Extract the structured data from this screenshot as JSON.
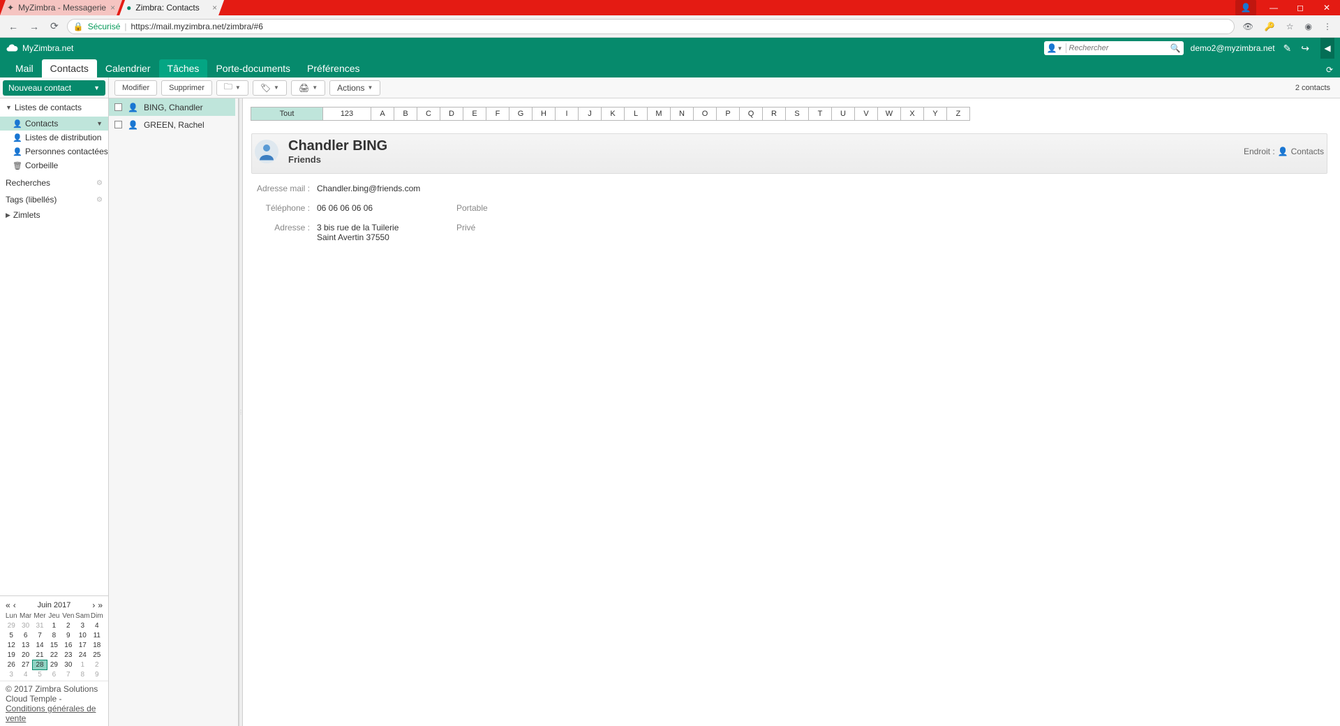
{
  "browser": {
    "tabs": [
      {
        "title": "MyZimbra - Messagerie"
      },
      {
        "title": "Zimbra: Contacts"
      }
    ],
    "url_secure": "Sécurisé",
    "url": "https://mail.myzimbra.net/zimbra/#6"
  },
  "header": {
    "logo": "MyZimbra.net",
    "search_placeholder": "Rechercher",
    "user": "demo2@myzimbra.net"
  },
  "nav": {
    "tabs": [
      "Mail",
      "Contacts",
      "Calendrier",
      "Tâches",
      "Porte-documents",
      "Préférences"
    ]
  },
  "sidebar": {
    "new_button": "Nouveau contact",
    "lists_header": "Listes de contacts",
    "items": [
      {
        "icon": "person",
        "label": "Contacts",
        "active": true,
        "dd": true
      },
      {
        "icon": "person",
        "label": "Listes de distribution"
      },
      {
        "icon": "person",
        "label": "Personnes contactées par m"
      },
      {
        "icon": "trash",
        "label": "Corbeille"
      }
    ],
    "recherches": "Recherches",
    "tags": "Tags (libellés)",
    "zimlets": "Zimlets"
  },
  "toolbar": {
    "modifier": "Modifier",
    "supprimer": "Supprimer",
    "actions": "Actions",
    "count": "2 contacts"
  },
  "alpha": {
    "all": "Tout",
    "num": "123",
    "letters": [
      "A",
      "B",
      "C",
      "D",
      "E",
      "F",
      "G",
      "H",
      "I",
      "J",
      "K",
      "L",
      "M",
      "N",
      "O",
      "P",
      "Q",
      "R",
      "S",
      "T",
      "U",
      "V",
      "W",
      "X",
      "Y",
      "Z"
    ]
  },
  "list": [
    {
      "name": "BING, Chandler",
      "selected": true
    },
    {
      "name": "GREEN, Rachel"
    }
  ],
  "detail": {
    "name": "Chandler BING",
    "org": "Friends",
    "location_label": "Endroit :",
    "location_value": "Contacts",
    "email_label": "Adresse mail :",
    "email": "Chandler.bing@friends.com",
    "phone_label": "Téléphone :",
    "phone": "06 06 06 06 06",
    "phone_type": "Portable",
    "address_label": "Adresse :",
    "address_l1": "3 bis rue de la Tuilerie",
    "address_l2": "Saint Avertin 37550",
    "address_type": "Privé"
  },
  "calendar": {
    "title": "Juin 2017",
    "day_headers": [
      "Lun",
      "Mar",
      "Mer",
      "Jeu",
      "Ven",
      "Sam",
      "Dim"
    ],
    "weeks": [
      [
        {
          "n": "29",
          "m": true
        },
        {
          "n": "30",
          "m": true
        },
        {
          "n": "31",
          "m": true
        },
        {
          "n": "1"
        },
        {
          "n": "2"
        },
        {
          "n": "3"
        },
        {
          "n": "4"
        }
      ],
      [
        {
          "n": "5"
        },
        {
          "n": "6"
        },
        {
          "n": "7"
        },
        {
          "n": "8"
        },
        {
          "n": "9"
        },
        {
          "n": "10"
        },
        {
          "n": "11"
        }
      ],
      [
        {
          "n": "12"
        },
        {
          "n": "13"
        },
        {
          "n": "14"
        },
        {
          "n": "15"
        },
        {
          "n": "16"
        },
        {
          "n": "17"
        },
        {
          "n": "18"
        }
      ],
      [
        {
          "n": "19"
        },
        {
          "n": "20"
        },
        {
          "n": "21"
        },
        {
          "n": "22"
        },
        {
          "n": "23"
        },
        {
          "n": "24"
        },
        {
          "n": "25"
        }
      ],
      [
        {
          "n": "26"
        },
        {
          "n": "27"
        },
        {
          "n": "28",
          "t": true
        },
        {
          "n": "29"
        },
        {
          "n": "30"
        },
        {
          "n": "1",
          "m": true
        },
        {
          "n": "2",
          "m": true
        }
      ],
      [
        {
          "n": "3",
          "m": true
        },
        {
          "n": "4",
          "m": true
        },
        {
          "n": "5",
          "m": true
        },
        {
          "n": "6",
          "m": true
        },
        {
          "n": "7",
          "m": true
        },
        {
          "n": "8",
          "m": true
        },
        {
          "n": "9",
          "m": true
        }
      ]
    ]
  },
  "footer": {
    "copyright": "© 2017 Zimbra Solutions Cloud Temple - ",
    "terms": "Conditions générales de vente"
  }
}
